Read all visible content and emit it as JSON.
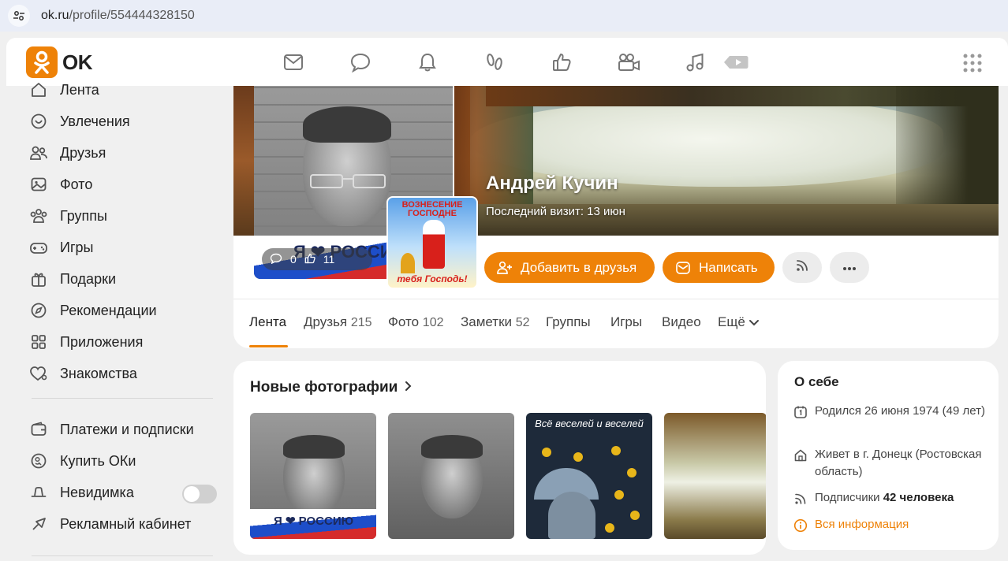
{
  "browser": {
    "url_host": "ok.ru",
    "url_path": "/profile/554444328150"
  },
  "header": {
    "logo_text": "OK",
    "nav_icons": [
      "mail-icon",
      "chat-icon",
      "bell-icon",
      "footprints-icon",
      "like-icon",
      "video-camera-icon",
      "music-icon",
      "video-play-icon"
    ],
    "apps_icon": "apps-grid-icon"
  },
  "sidebar": {
    "items": [
      {
        "label": "Лента",
        "icon": "home-icon"
      },
      {
        "label": "Увлечения",
        "icon": "hobbies-icon"
      },
      {
        "label": "Друзья",
        "icon": "friends-icon"
      },
      {
        "label": "Фото",
        "icon": "photo-icon"
      },
      {
        "label": "Группы",
        "icon": "groups-icon"
      },
      {
        "label": "Игры",
        "icon": "gamepad-icon"
      },
      {
        "label": "Подарки",
        "icon": "gift-icon"
      },
      {
        "label": "Рекомендации",
        "icon": "compass-icon"
      },
      {
        "label": "Приложения",
        "icon": "apps-icon"
      },
      {
        "label": "Знакомства",
        "icon": "dating-heart-icon"
      }
    ],
    "items2": [
      {
        "label": "Платежи и подписки",
        "icon": "wallet-icon"
      },
      {
        "label": "Купить ОКи",
        "icon": "coins-icon"
      },
      {
        "label": "Невидимка",
        "icon": "invisible-hat-icon",
        "toggle": false
      },
      {
        "label": "Рекламный кабинет",
        "icon": "ad-cabinet-icon"
      }
    ]
  },
  "profile": {
    "name": "Андрей Кучин",
    "last_visit": "Последний визит: 13 июн",
    "avatar_banner": "Я ❤ РОССИ",
    "avatar_comments": "0",
    "avatar_likes": "11",
    "badge_title": "ВОЗНЕСЕНИЕ ГОСПОДНЕ",
    "badge_footer": "тебя Господь!",
    "add_friend_label": "Добавить в друзья",
    "write_label": "Написать"
  },
  "tabs": [
    {
      "label": "Лента",
      "count": ""
    },
    {
      "label": "Друзья",
      "count": "215"
    },
    {
      "label": "Фото",
      "count": "102"
    },
    {
      "label": "Заметки",
      "count": "52"
    },
    {
      "label": "Группы",
      "count": ""
    },
    {
      "label": "Игры",
      "count": ""
    },
    {
      "label": "Видео",
      "count": ""
    },
    {
      "label": "Ещё",
      "count": ""
    }
  ],
  "photos": {
    "title": "Новые фотографии",
    "thumb1_text": "Я ❤ РОССИЮ",
    "thumb3_text": "Всё веселей и веселей"
  },
  "about": {
    "title": "О себе",
    "born": "Родился 26 июня 1974 (49 лет)",
    "lives": "Живет в г. Донецк (Ростовская область)",
    "subscribers_label": "Подписчики",
    "subscribers_value": "42 человека",
    "all_info": "Вся информация"
  },
  "colors": {
    "accent": "#ee8208",
    "background": "#f0f0f0"
  }
}
